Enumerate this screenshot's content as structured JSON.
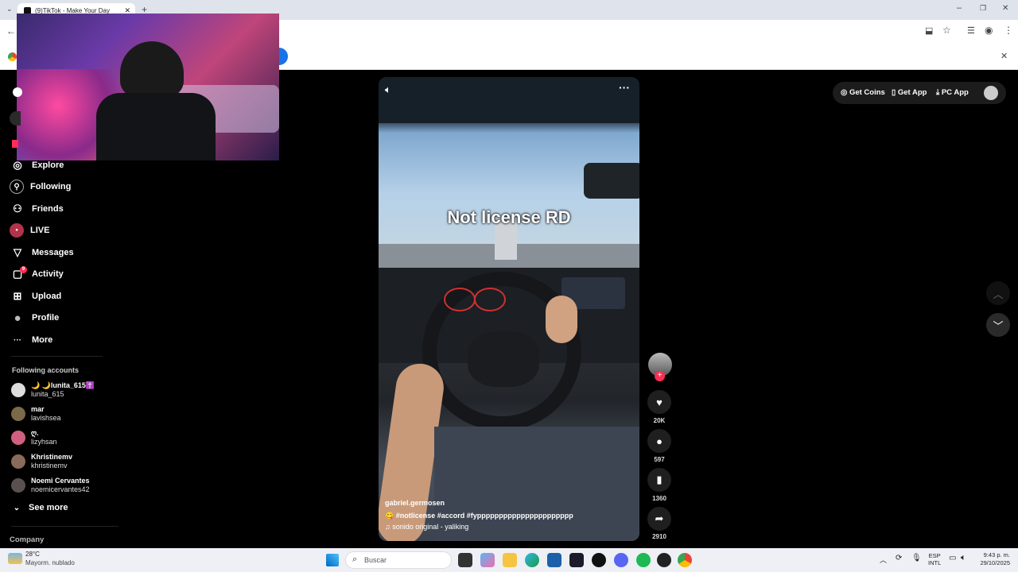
{
  "browser": {
    "tab_title": "(9)TikTok - Make Your Day",
    "new_tab": "+",
    "window_controls": [
      "–",
      "❐",
      "✕"
    ],
    "infobar_close": "✕"
  },
  "sidebar": {
    "nav": [
      {
        "label": "Explore",
        "icon": "compass-icon",
        "glyph": "◎"
      },
      {
        "label": "Following",
        "icon": "following-icon",
        "glyph": "⚲"
      },
      {
        "label": "Friends",
        "icon": "friends-icon",
        "glyph": "⚇"
      },
      {
        "label": "LIVE",
        "icon": "live-icon",
        "glyph": "●"
      },
      {
        "label": "Messages",
        "icon": "messages-icon",
        "glyph": "▽"
      },
      {
        "label": "Activity",
        "icon": "activity-icon",
        "glyph": "▢",
        "badge": "9"
      },
      {
        "label": "Upload",
        "icon": "upload-icon",
        "glyph": "⊞"
      },
      {
        "label": "Profile",
        "icon": "profile-icon",
        "glyph": "●"
      },
      {
        "label": "More",
        "icon": "more-icon",
        "glyph": "···"
      }
    ],
    "following_title": "Following accounts",
    "accounts": [
      {
        "name": "🌙 🌙lunita_615✝️",
        "handle": "lunita_615"
      },
      {
        "name": "mar",
        "handle": "lavishsea"
      },
      {
        "name": "ღ.",
        "handle": "lizyhsan"
      },
      {
        "name": "Khristinemv",
        "handle": "khristinemv"
      },
      {
        "name": "Noemi Cervantes",
        "handle": "noemicervantes42"
      }
    ],
    "see_more": "See more",
    "company": "Company"
  },
  "video": {
    "caption_overlay": "Not license RD",
    "author": "gabriel.germosen",
    "hashtags": "#notlicense  #accord  #fypppppppppppppppppppppp",
    "sound": "sonido original - yaliking",
    "mute_icon": "speaker-icon",
    "more_icon": "ellipsis-icon"
  },
  "actions": {
    "likes": "20K",
    "comments": "597",
    "saves": "1360",
    "shares": "2910"
  },
  "topbar": {
    "get_coins": "Get Coins",
    "get_app": "Get App",
    "pc_app": "PC App"
  },
  "taskbar": {
    "weather_temp": "28°C",
    "weather_desc": "Mayorm. nublado",
    "search_placeholder": "Buscar",
    "lang_top": "ESP",
    "lang_bottom": "INTL",
    "time": "9:43 p. m.",
    "date": "29/10/2025"
  },
  "colors": {
    "accent": "#fe2c55",
    "tab_bg": "#dfe3eb",
    "taskbar_bg": "#eef0f5"
  }
}
